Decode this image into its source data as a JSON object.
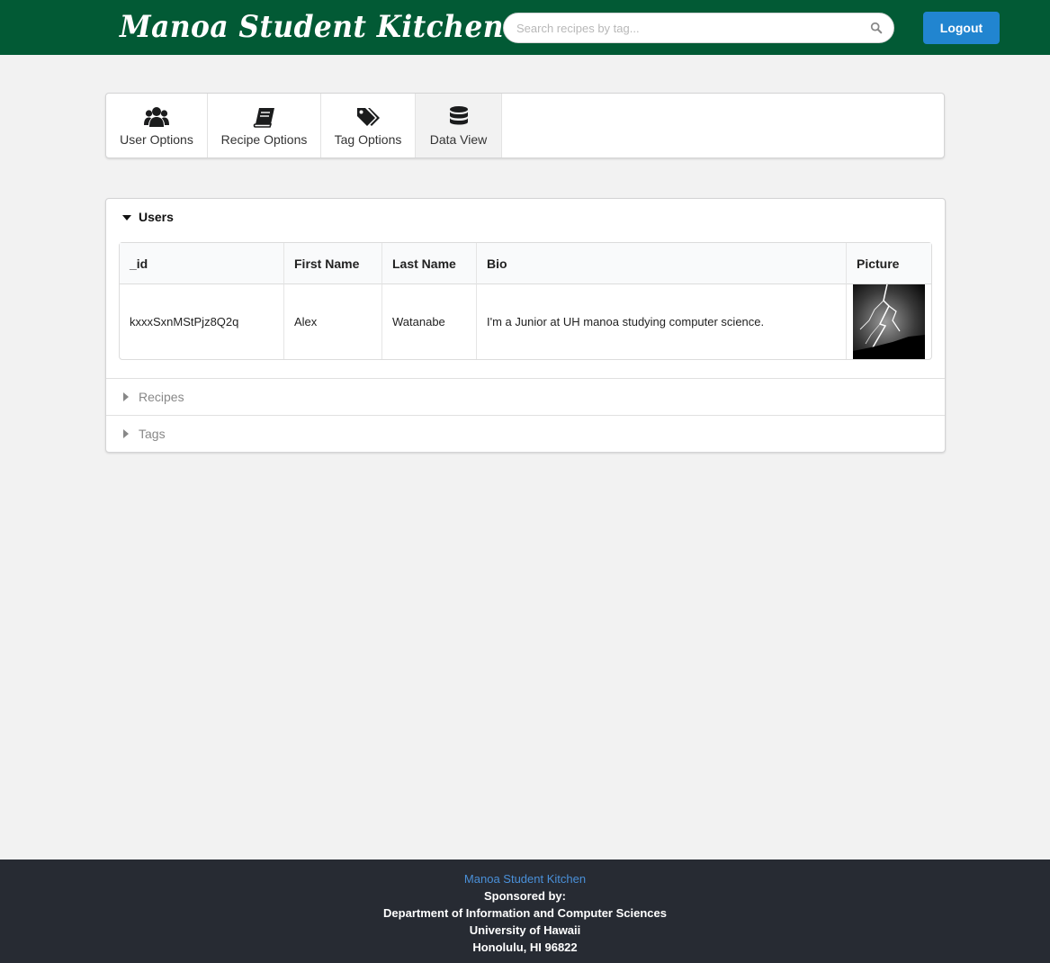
{
  "header": {
    "brand": "Manoa Student Kitchen",
    "search_placeholder": "Search recipes by tag...",
    "logout_label": "Logout"
  },
  "tabs": [
    {
      "label": "User Options",
      "icon": "users-icon",
      "active": false
    },
    {
      "label": "Recipe Options",
      "icon": "book-icon",
      "active": false
    },
    {
      "label": "Tag Options",
      "icon": "tags-icon",
      "active": false
    },
    {
      "label": "Data View",
      "icon": "database-icon",
      "active": true
    }
  ],
  "accordion": {
    "sections": [
      {
        "title": "Users",
        "expanded": true
      },
      {
        "title": "Recipes",
        "expanded": false
      },
      {
        "title": "Tags",
        "expanded": false
      }
    ],
    "users_table": {
      "columns": [
        "_id",
        "First Name",
        "Last Name",
        "Bio",
        "Picture"
      ],
      "rows": [
        {
          "id": "kxxxSxnMStPjz8Q2q",
          "first_name": "Alex",
          "last_name": "Watanabe",
          "bio": "I'm a Junior at UH manoa studying computer science.",
          "picture": "lightning-photo"
        }
      ]
    }
  },
  "footer": {
    "link": "Manoa Student Kitchen",
    "lines": [
      "Sponsored by:",
      "Department of Information and Computer Sciences",
      "University of Hawaii",
      "Honolulu, HI 96822"
    ]
  },
  "colors": {
    "navbar": "#025a35",
    "button": "#2185d0",
    "footer": "#272b33",
    "footer_link": "#4a90d9"
  }
}
